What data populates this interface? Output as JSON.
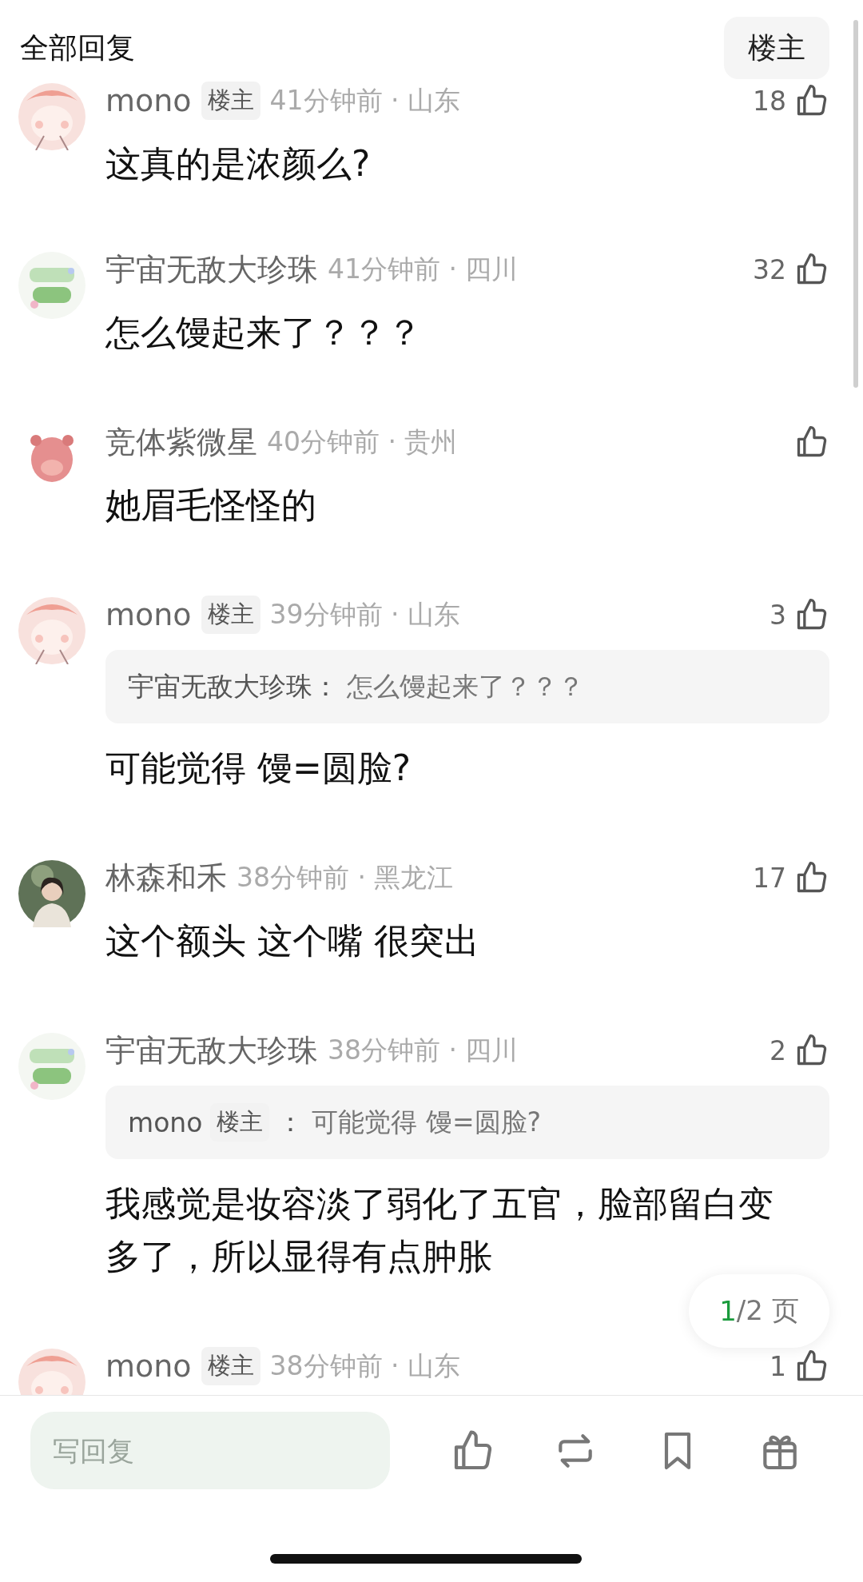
{
  "header": {
    "title": "全部回复",
    "filter_button": "楼主"
  },
  "comments": [
    {
      "avatar": {
        "kind": "pink"
      },
      "name": "mono",
      "badge": "楼主",
      "meta": "41分钟前 · 山东",
      "likes": "18",
      "text": "这真的是浓颜么?"
    },
    {
      "avatar": {
        "kind": "sticker"
      },
      "name": "宇宙无敌大珍珠",
      "meta": "41分钟前 · 四川",
      "likes": "32",
      "text": "怎么馒起来了？？？"
    },
    {
      "avatar": {
        "kind": "mascot"
      },
      "name": "竞体紫微星",
      "meta": "40分钟前 · 贵州",
      "text": "她眉毛怪怪的"
    },
    {
      "avatar": {
        "kind": "pink"
      },
      "name": "mono",
      "badge": "楼主",
      "meta": "39分钟前 · 山东",
      "likes": "3",
      "quote": {
        "name": "宇宙无敌大珍珠",
        "separator": "：",
        "text": "怎么馒起来了？？？"
      },
      "text": "可能觉得 馒=圆脸?"
    },
    {
      "avatar": {
        "kind": "photo"
      },
      "name": "林森和禾",
      "meta": "38分钟前 · 黑龙江",
      "likes": "17",
      "text": "这个额头 这个嘴 很突出"
    },
    {
      "avatar": {
        "kind": "sticker"
      },
      "name": "宇宙无敌大珍珠",
      "meta": "38分钟前 · 四川",
      "likes": "2",
      "quote": {
        "name": "mono",
        "badge": "楼主",
        "separator": "：",
        "text": "可能觉得 馒=圆脸?"
      },
      "text": "我感觉是妆容淡了弱化了五官，脸部留白变多了，所以显得有点肿胀"
    },
    {
      "avatar": {
        "kind": "pink"
      },
      "name": "mono",
      "badge": "楼主",
      "meta": "38分钟前 · 山东",
      "likes": "1"
    }
  ],
  "pager": {
    "current": "1",
    "rest": "/2 页"
  },
  "bottom_bar": {
    "placeholder": "写回复",
    "actions": [
      {
        "kind": "like"
      },
      {
        "kind": "repost"
      },
      {
        "kind": "bookmark"
      },
      {
        "kind": "gift"
      }
    ]
  }
}
